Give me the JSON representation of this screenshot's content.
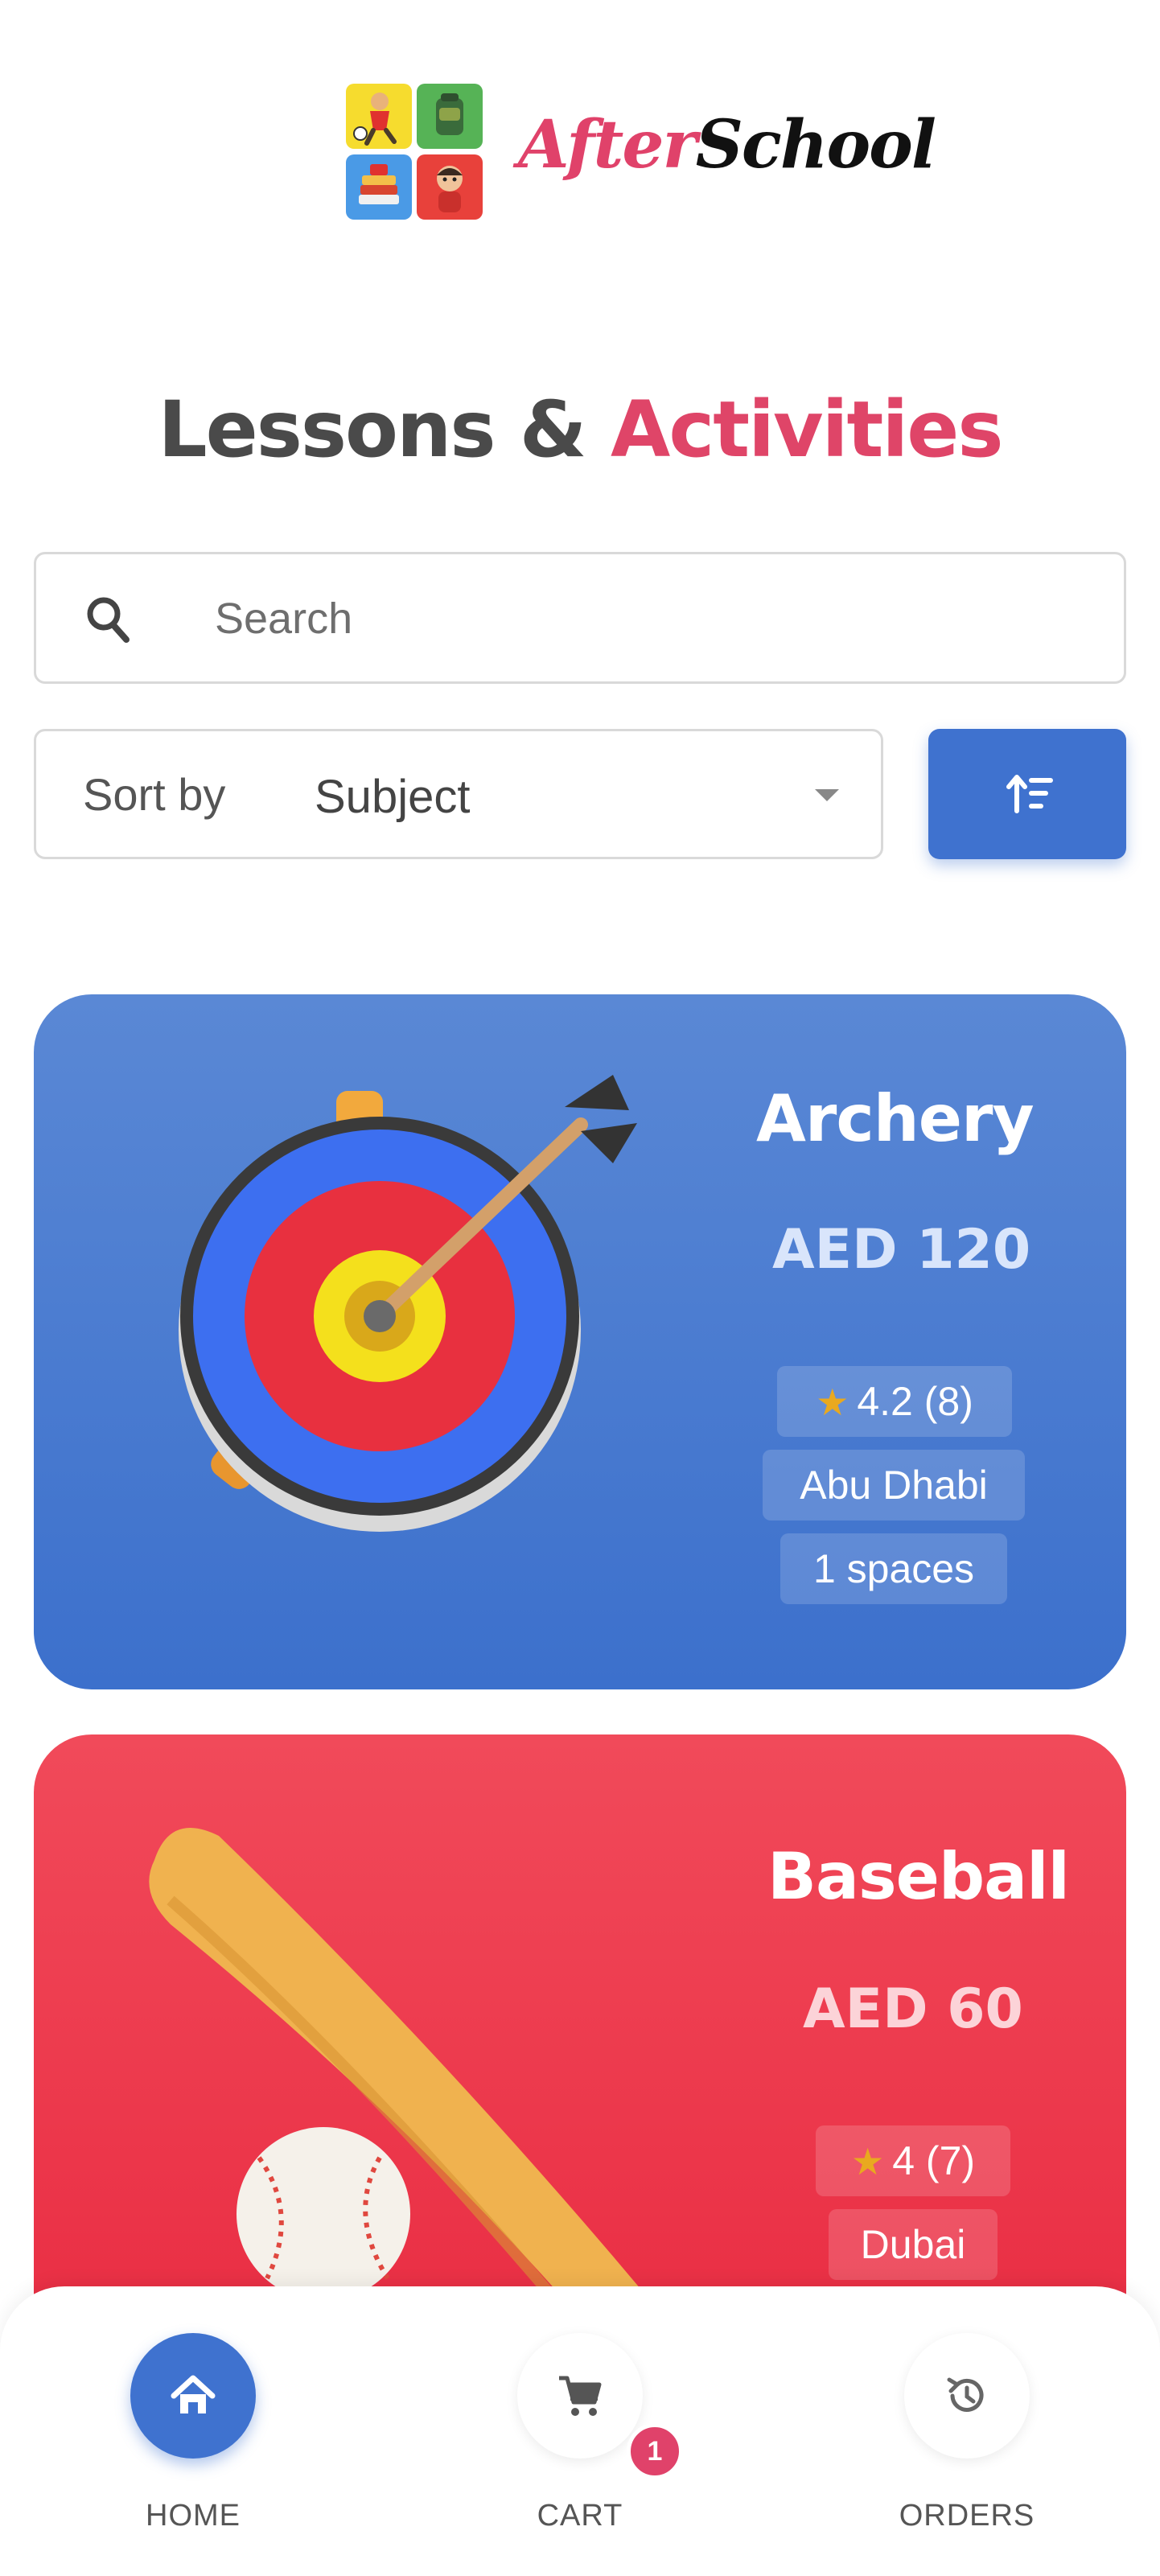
{
  "brand": {
    "logo_after": "After",
    "logo_school": "School",
    "accent_color": "#e0426a",
    "primary_color": "#3f72cf"
  },
  "page": {
    "title_main": "Lessons & ",
    "title_accent": "Activities"
  },
  "search": {
    "placeholder": "Search",
    "value": ""
  },
  "sort": {
    "label": "Sort by",
    "selected": "Subject",
    "order_icon": "sort-ascending-icon"
  },
  "lessons": [
    {
      "subject": "Archery",
      "price": "AED 120",
      "rating": "4.2 (8)",
      "location": "Abu Dhabi",
      "spaces": "1 spaces",
      "image": "archery-target-icon",
      "color": "#4a7dd1"
    },
    {
      "subject": "Baseball",
      "price": "AED 60",
      "rating": "4 (7)",
      "location": "Dubai",
      "image": "baseball-bat-icon",
      "color": "#ec3348"
    }
  ],
  "nav": {
    "home": "HOME",
    "cart": "CART",
    "orders": "ORDERS",
    "cart_count": "1"
  }
}
